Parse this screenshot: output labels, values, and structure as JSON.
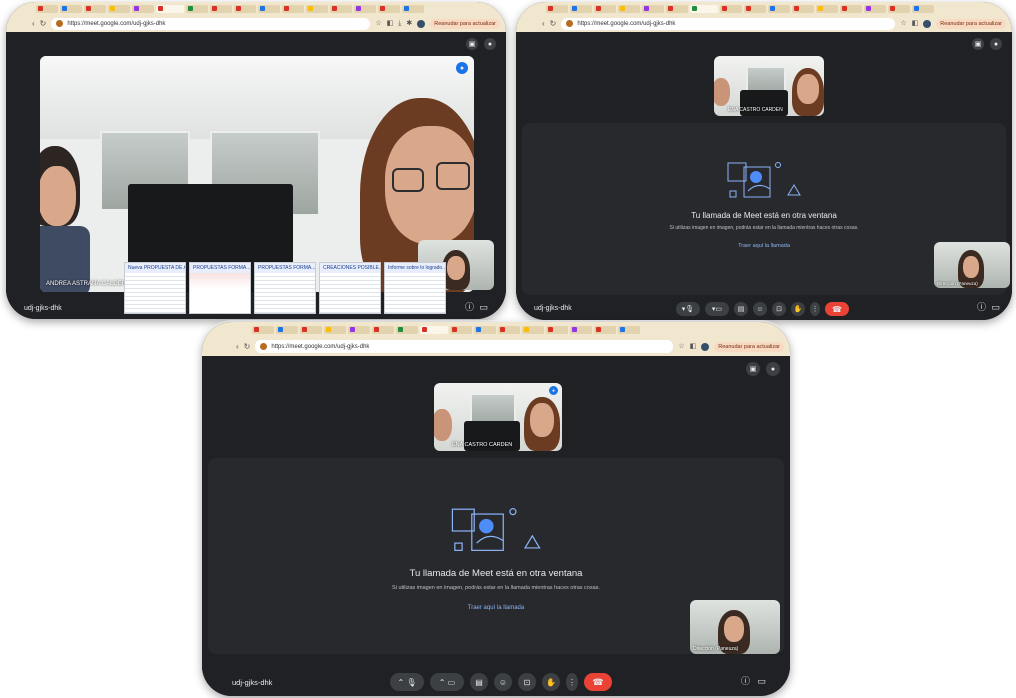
{
  "browser": {
    "url": "https://meet.google.com/udj-gjks-dhk",
    "update_button": "Reanudar para actualizar",
    "tab_colors": [
      "#d93025",
      "#1a73e8",
      "#d93025",
      "#fbbc04",
      "#9334e6",
      "#d93025",
      "#1e8e3e",
      "#d93025",
      "#d93025",
      "#1a73e8",
      "#d93025",
      "#fbbc04",
      "#d93025",
      "#9334e6",
      "#d93025",
      "#1a73e8"
    ]
  },
  "meeting": {
    "code": "udj-gjks-dhk",
    "participant_name_partial": "ENA CASTRO CARDEN",
    "self_name": "Dirección (Paneuza)",
    "pip_title": "Tu llamada de Meet está en otra ventana",
    "pip_subtitle": "Si utilizas imagen en imagen, podrás estar en la llamada mientras haces otras cosas.",
    "pip_link": "Traer aquí la llamada"
  },
  "panel1": {
    "name_tag": "ANDREA ASTRANA CALDERON",
    "taskbar_windows": [
      {
        "title": "Nueva PROPUESTA DE A..."
      },
      {
        "title": "PROPUESTAS FORMA..."
      },
      {
        "title": "PROPUESTAS FORMA..."
      },
      {
        "title": "CREACIONES POSIBLE..."
      },
      {
        "title": "Informe sobre lo logrado..."
      }
    ]
  },
  "icons": {
    "mic": "mic-icon",
    "camera": "camera-icon",
    "captions": "captions-icon",
    "emoji": "emoji-icon",
    "present": "present-icon",
    "hand": "raise-hand-icon",
    "more": "more-options-icon",
    "hangup": "hangup-icon"
  },
  "colors": {
    "meet_bg": "#202124",
    "stage_bg": "#28292c",
    "end_call": "#ea4335",
    "link": "#8ab4f8"
  }
}
